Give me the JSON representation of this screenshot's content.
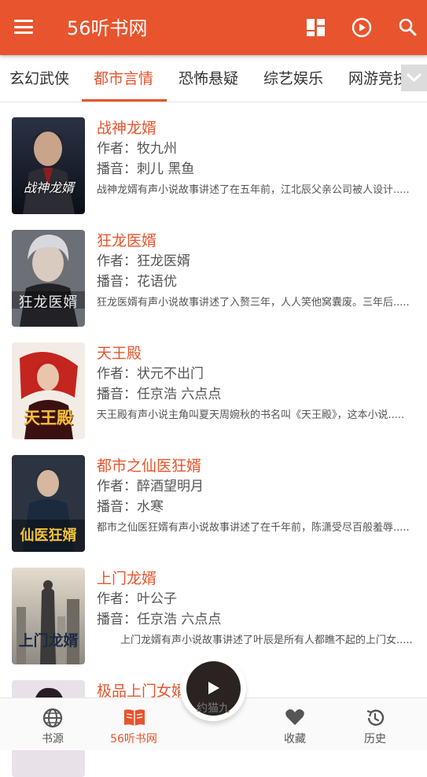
{
  "app": {
    "title": "56听书网"
  },
  "toolbar": {
    "icons": [
      "menu-icon",
      "grid-icon",
      "play-circle-icon",
      "search-icon"
    ]
  },
  "tabs": [
    {
      "label": "玄幻武侠"
    },
    {
      "label": "都市言情"
    },
    {
      "label": "恐怖悬疑"
    },
    {
      "label": "综艺娱乐"
    },
    {
      "label": "网游竞技"
    }
  ],
  "active_tab": "都市言情",
  "colors": {
    "accent": "#e8542d",
    "topbar": "#e8542d",
    "play_button": "#2a2321"
  },
  "books": [
    {
      "title": "战神龙婿",
      "author": "作者：牧九州",
      "narrator": "播音：刺儿 黑鱼",
      "desc": "战神龙婿有声小说故事讲述了在五年前，江北辰父亲公司被人设计.....",
      "cover_text": "战神龙婿"
    },
    {
      "title": "狂龙医婿",
      "author": "作者：狂龙医婿",
      "narrator": "播音：花语优",
      "desc": "狂龙医婿有声小说故事讲述了入赘三年，人人笑他窝囊废。三年后.....",
      "cover_text": "狂龙医婿"
    },
    {
      "title": "天王殿",
      "author": "作者：状元不出门",
      "narrator": "播音：任京浩 六点点",
      "desc": "天王殿有声小说主角叫夏天周婉秋的书名叫《天王殿》，这本小说.....",
      "cover_text": "天王殿"
    },
    {
      "title": "都市之仙医狂婿",
      "author": "作者：醉酒望明月",
      "narrator": "播音：水寒",
      "desc": "都市之仙医狂婿有声小说故事讲述了在千年前，陈潇受尽百般羞辱.....",
      "cover_text": "仙医狂婿"
    },
    {
      "title": "上门龙婿",
      "author": "作者：叶公子",
      "narrator": "播音：任京浩 六点点",
      "desc": "上门龙婿有声小说故事讲述了叶辰是所有人都瞧不起的上门女.....",
      "cover_text": "上门龙婿"
    },
    {
      "title": "极品上门女婿",
      "author": "",
      "narrator": "",
      "desc": "",
      "cover_text": ""
    }
  ],
  "bottom_nav": [
    {
      "label": "书源",
      "icon": "globe-icon"
    },
    {
      "label": "56听书网",
      "icon": "book-icon"
    },
    {
      "label": "收藏",
      "icon": "heart-icon"
    },
    {
      "label": "历史",
      "icon": "history-icon"
    }
  ],
  "player": {
    "label": "约猫九"
  }
}
